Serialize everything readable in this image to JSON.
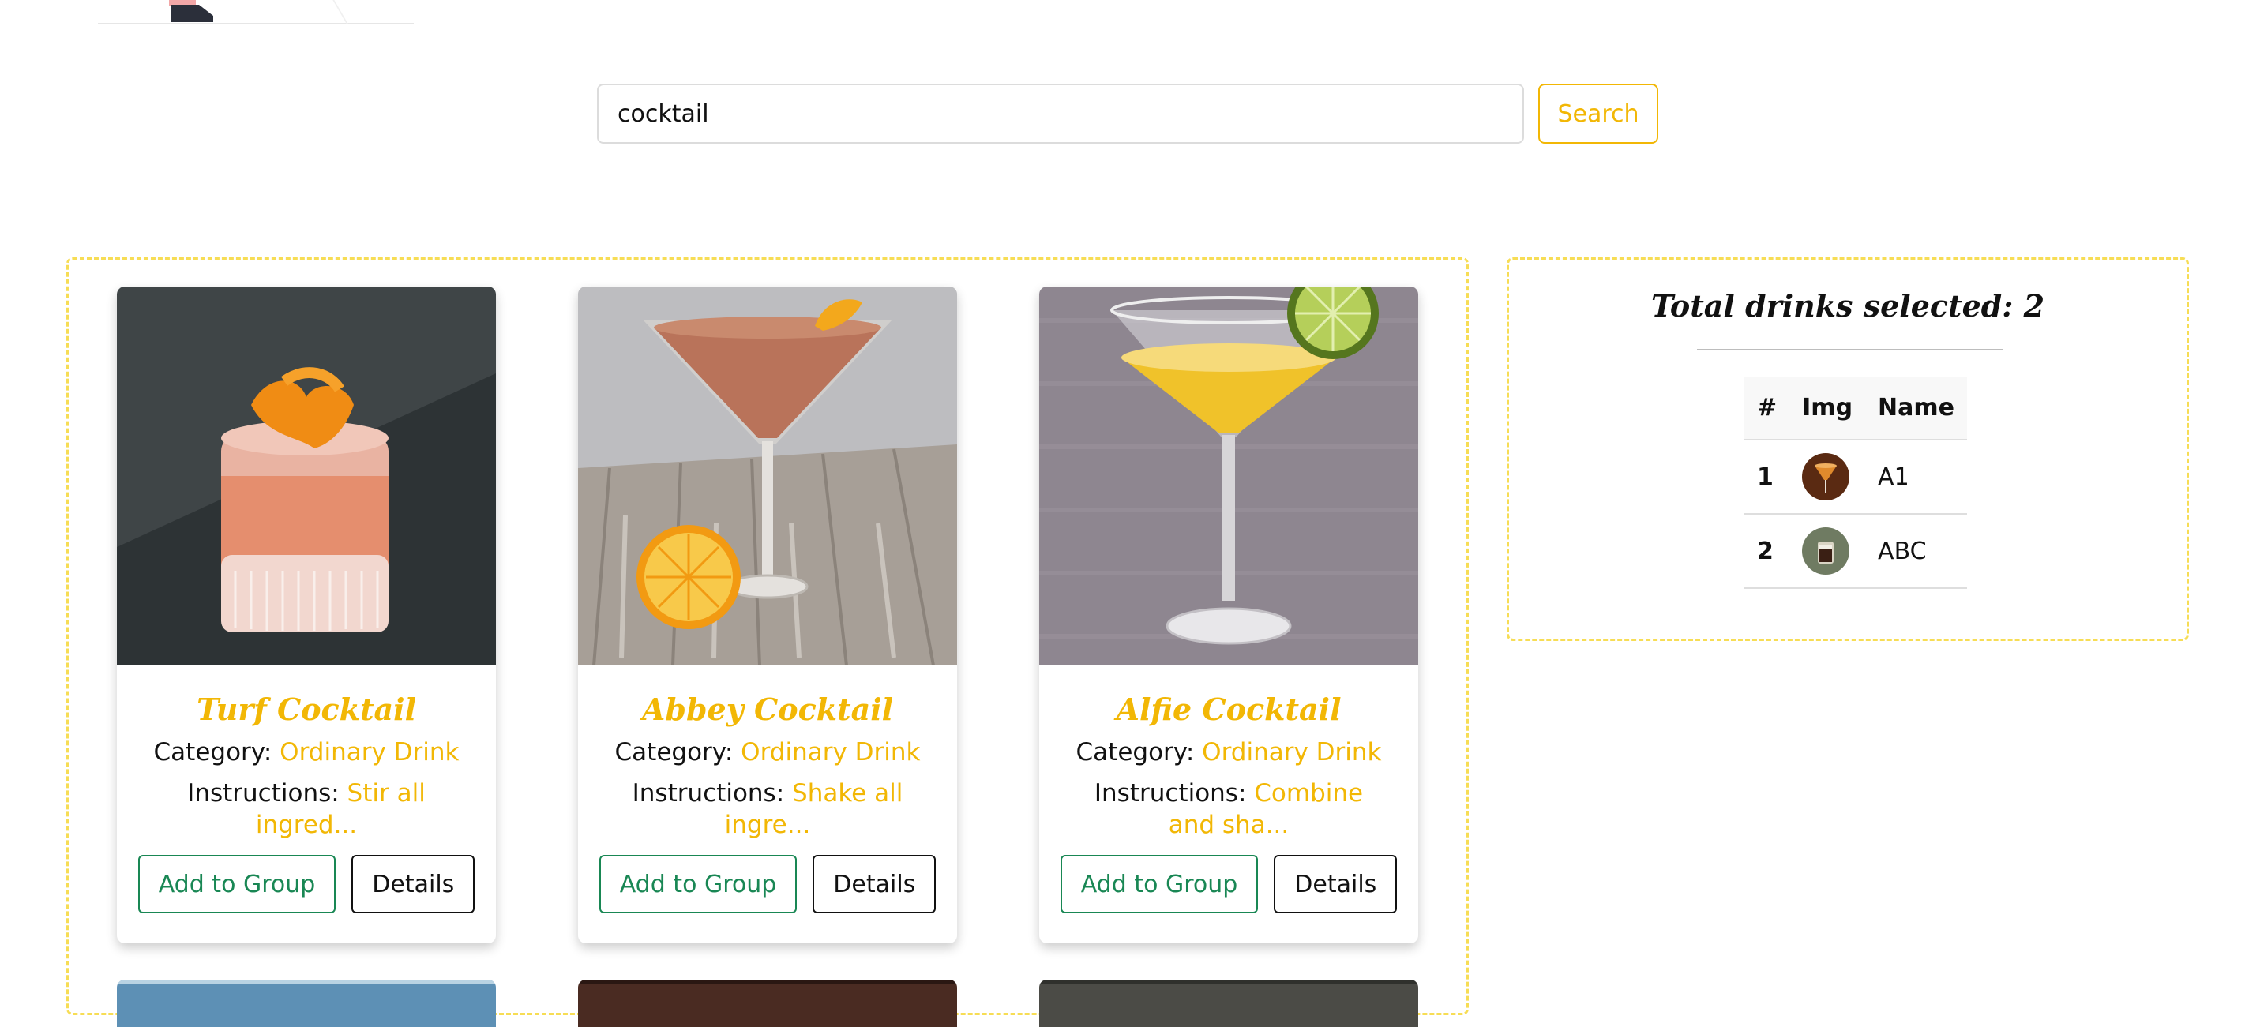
{
  "search": {
    "value": "cocktail",
    "button_label": "Search"
  },
  "drinks": [
    {
      "name": "Turf Cocktail",
      "category_label": "Category:",
      "category": "Ordinary Drink",
      "instructions_label": "Instructions:",
      "instructions": "Stir all ingred...",
      "add_label": "Add to Group",
      "details_label": "Details"
    },
    {
      "name": "Abbey Cocktail",
      "category_label": "Category:",
      "category": "Ordinary Drink",
      "instructions_label": "Instructions:",
      "instructions": "Shake all ingre...",
      "add_label": "Add to Group",
      "details_label": "Details"
    },
    {
      "name": "Alfie Cocktail",
      "category_label": "Category:",
      "category": "Ordinary Drink",
      "instructions_label": "Instructions:",
      "instructions": "Combine and sha...",
      "add_label": "Add to Group",
      "details_label": "Details"
    }
  ],
  "selection": {
    "title": "Total drinks selected: 2",
    "columns": [
      "#",
      "Img",
      "Name"
    ],
    "rows": [
      {
        "num": "1",
        "name": "A1"
      },
      {
        "num": "2",
        "name": "ABC"
      }
    ]
  },
  "colors": {
    "accent": "#f2b705",
    "success": "#198754",
    "panel_border": "#f7dd55"
  }
}
